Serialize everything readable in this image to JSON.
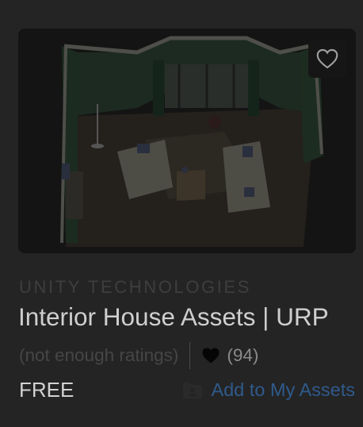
{
  "asset": {
    "publisher": "UNITY TECHNOLOGIES",
    "title": "Interior House Assets | URP",
    "rating_text": "(not enough ratings)",
    "favorites_count": "(94)",
    "price": "FREE",
    "add_label": "Add to My Assets",
    "thumbnail_alt": "Interior room render with green walls, sofas and bay window"
  },
  "icons": {
    "favorite": "heart-outline-icon",
    "favorites_count": "heart-filled-icon",
    "add": "folder-user-icon"
  },
  "colors": {
    "background": "#242424",
    "publisher": "#3e3e3e",
    "title": "#cfcfcf",
    "link": "#2f5a8c",
    "price": "#d2d2d2"
  }
}
